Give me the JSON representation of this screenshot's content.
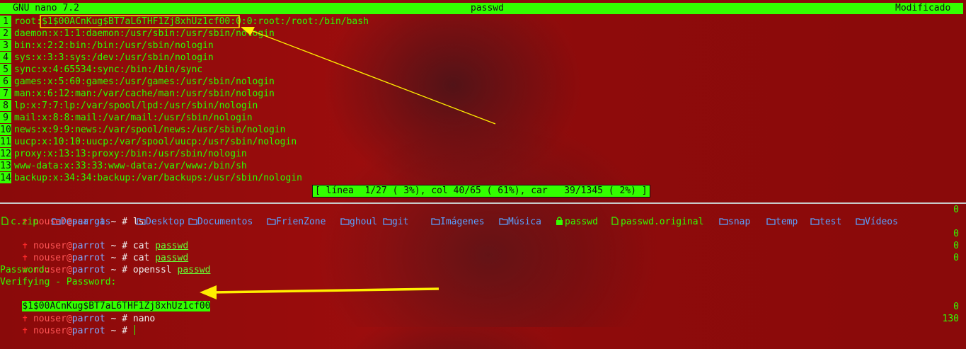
{
  "nano": {
    "app_title": "GNU nano 7.2",
    "file_name": "passwd",
    "state": "Modificado",
    "lines": [
      {
        "n": "1",
        "text": "root:$1$00ACnKug$BT7aL6THF1Zj8xhUz1cf00:0:0:root:/root:/bin/bash"
      },
      {
        "n": "2",
        "text": "daemon:x:1:1:daemon:/usr/sbin:/usr/sbin/nologin"
      },
      {
        "n": "3",
        "text": "bin:x:2:2:bin:/bin:/usr/sbin/nologin"
      },
      {
        "n": "4",
        "text": "sys:x:3:3:sys:/dev:/usr/sbin/nologin"
      },
      {
        "n": "5",
        "text": "sync:x:4:65534:sync:/bin:/bin/sync"
      },
      {
        "n": "6",
        "text": "games:x:5:60:games:/usr/games:/usr/sbin/nologin"
      },
      {
        "n": "7",
        "text": "man:x:6:12:man:/var/cache/man:/usr/sbin/nologin"
      },
      {
        "n": "8",
        "text": "lp:x:7:7:lp:/var/spool/lpd:/usr/sbin/nologin"
      },
      {
        "n": "9",
        "text": "mail:x:8:8:mail:/var/mail:/usr/sbin/nologin"
      },
      {
        "n": "10",
        "text": "news:x:9:9:news:/var/spool/news:/usr/sbin/nologin"
      },
      {
        "n": "11",
        "text": "uucp:x:10:10:uucp:/var/spool/uucp:/usr/sbin/nologin"
      },
      {
        "n": "12",
        "text": "proxy:x:13:13:proxy:/bin:/usr/sbin/nologin"
      },
      {
        "n": "13",
        "text": "www-data:x:33:33:www-data:/var/www:/bin/sh"
      },
      {
        "n": "14",
        "text": "backup:x:34:34:backup:/var/backups:/usr/sbin/nologin"
      }
    ],
    "status_bar": "[ línea  1/27 ( 3%), col 40/65 ( 61%), car   39/1345 ( 2%) ]"
  },
  "prompt": {
    "cross": "✝",
    "user": "nouser",
    "at": "@",
    "host": "parrot",
    "path": " ~ # "
  },
  "terminal": {
    "cmd1": "ls",
    "cmd1_code": "0",
    "ls_items": [
      {
        "name": "c.zip",
        "icon": "file-icon"
      },
      {
        "name": "Descargas",
        "icon": "folder-icon"
      },
      {
        "name": "Desktop",
        "icon": "folder-icon"
      },
      {
        "name": "Documentos",
        "icon": "folder-icon"
      },
      {
        "name": "FrienZone",
        "icon": "folder-icon"
      },
      {
        "name": "ghoul",
        "icon": "folder-icon"
      },
      {
        "name": "git",
        "icon": "folder-icon"
      },
      {
        "name": "Imágenes",
        "icon": "folder-icon"
      },
      {
        "name": "Música",
        "icon": "folder-icon"
      },
      {
        "name": "passwd",
        "icon": "lock-icon"
      },
      {
        "name": "passwd.original",
        "icon": "file-icon"
      },
      {
        "name": "snap",
        "icon": "folder-icon"
      },
      {
        "name": "temp",
        "icon": "folder-icon"
      },
      {
        "name": "test",
        "icon": "folder-icon"
      },
      {
        "name": "Vídeos",
        "icon": "folder-icon"
      }
    ],
    "cmd2": "cat",
    "cmd2_arg": "passwd",
    "cmd2_code": "0",
    "cmd3": "cat",
    "cmd3_arg": "passwd",
    "cmd3_code": "0",
    "cmd4": "openssl",
    "cmd4_arg": "passwd",
    "cmd4_code": "0",
    "out1": "Password:",
    "out2": "Verifying - Password:",
    "hash": "$1$00ACnKug$BT7aL6THF1Zj8xhUz1cf00",
    "cmd5": "nano",
    "cmd5_code": "0",
    "last_code": "130"
  },
  "colors": {
    "accent_green": "#33ff00",
    "arrow_yellow": "#ffee00"
  }
}
